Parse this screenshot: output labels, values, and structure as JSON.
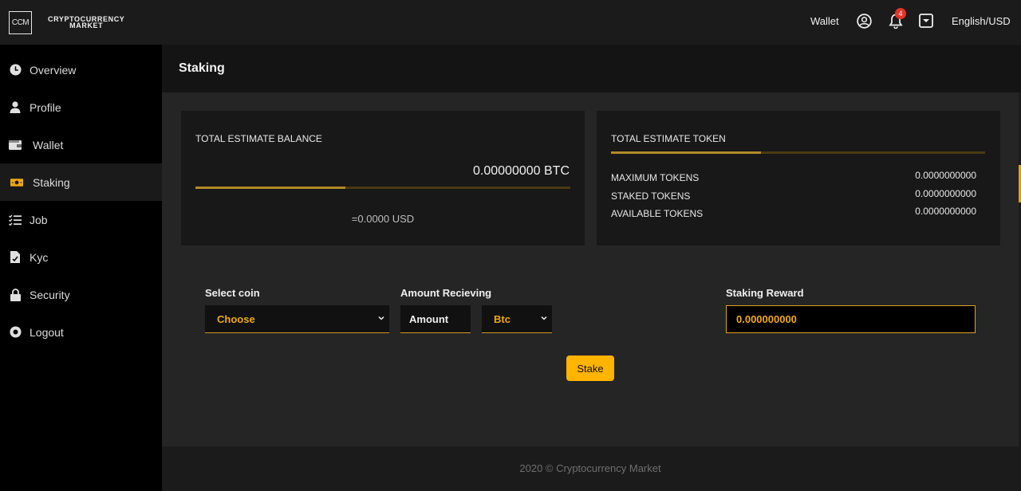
{
  "brand": {
    "logo_mark": "CCM",
    "name_line1": "CRYPTOCURRENCY",
    "name_line2": "MARKET"
  },
  "sidebar": {
    "items": [
      {
        "label": "Overview",
        "icon": "clock-icon"
      },
      {
        "label": "Profile",
        "icon": "user-icon"
      },
      {
        "label": "Wallet",
        "icon": "wallet-icon"
      },
      {
        "label": "Staking",
        "icon": "money-icon",
        "active": true
      },
      {
        "label": "Job",
        "icon": "list-icon"
      },
      {
        "label": "Kyc",
        "icon": "document-icon"
      },
      {
        "label": "Security",
        "icon": "lock-icon"
      },
      {
        "label": "Logout",
        "icon": "logout-icon"
      }
    ]
  },
  "topbar": {
    "wallet_label": "Wallet",
    "notification_count": "4",
    "language": "English/USD"
  },
  "page": {
    "title": "Staking"
  },
  "balance_card": {
    "title": "TOTAL ESTIMATE BALANCE",
    "balance": "0.00000000 BTC",
    "usd": "=0.0000 USD",
    "progress_fraction": 0.4
  },
  "token_card": {
    "title": "TOTAL ESTIMATE TOKEN",
    "progress_fraction": 0.4,
    "rows": [
      {
        "label": "MAXIMUM TOKENS",
        "value": "0.0000000000"
      },
      {
        "label": "STAKED TOKENS",
        "value": "0.0000000000"
      },
      {
        "label": "AVAILABLE TOKENS",
        "value": "0.0000000000"
      }
    ]
  },
  "form": {
    "select_coin_label": "Select coin",
    "select_coin_value": "Choose",
    "amount_label": "Amount Recieving",
    "amount_placeholder": "Amount",
    "currency_value": "Btc",
    "reward_label": "Staking Reward",
    "reward_value": "0.000000000",
    "stake_button": "Stake"
  },
  "footer": {
    "text": "2020 © Cryptocurrency Market"
  },
  "colors": {
    "accent": "#ffb400",
    "accent_text": "#f0a90f",
    "badge": "#e53227"
  }
}
